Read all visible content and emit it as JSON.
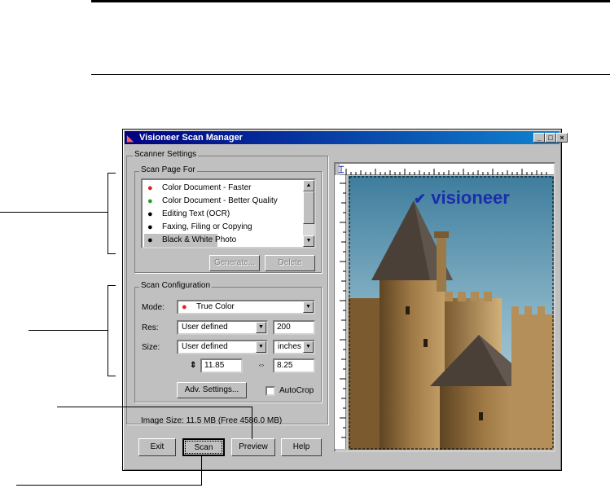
{
  "window": {
    "title": "Visioneer Scan Manager",
    "title_buttons": [
      "_",
      "□",
      "×"
    ]
  },
  "scanner_settings": {
    "group_label": "Scanner Settings",
    "scan_page_for": {
      "group_label": "Scan Page For",
      "items": [
        {
          "label": "Color Document - Faster",
          "icon": "color-dots-icon",
          "selected": false
        },
        {
          "label": "Color Document - Better Quality",
          "icon": "color-dots-icon",
          "selected": false
        },
        {
          "label": "Editing Text (OCR)",
          "icon": "black-dot-icon",
          "selected": false
        },
        {
          "label": "Faxing, Filing or Copying",
          "icon": "black-dot-icon",
          "selected": false
        },
        {
          "label": "Black & White Photo",
          "icon": "black-dot-icon",
          "selected": true
        }
      ],
      "generate_label": "Generate...",
      "delete_label": "Delete"
    },
    "scan_configuration": {
      "group_label": "Scan Configuration",
      "mode_label": "Mode:",
      "mode_value": "True Color",
      "res_label": "Res:",
      "res_select": "User defined",
      "res_value": "200",
      "size_label": "Size:",
      "size_select": "User defined",
      "units_value": "inches",
      "height_value": "11.85",
      "width_value": "8.25",
      "adv_settings_label": "Adv. Settings...",
      "autocrop_label": "AutoCrop",
      "autocrop_checked": false
    },
    "image_size_text": "Image Size: 11.5 MB (Free 4586.0 MB)"
  },
  "bottom_buttons": {
    "exit": "Exit",
    "scan": "Scan",
    "preview": "Preview",
    "help": "Help"
  },
  "preview": {
    "logo_text": "visioneer",
    "ruler_corner_icon": "ruler-origin-icon"
  },
  "colors": {
    "title_bar": "#000080",
    "window_face": "#c0c0c0",
    "logo_blue": "#1b2ea8"
  }
}
